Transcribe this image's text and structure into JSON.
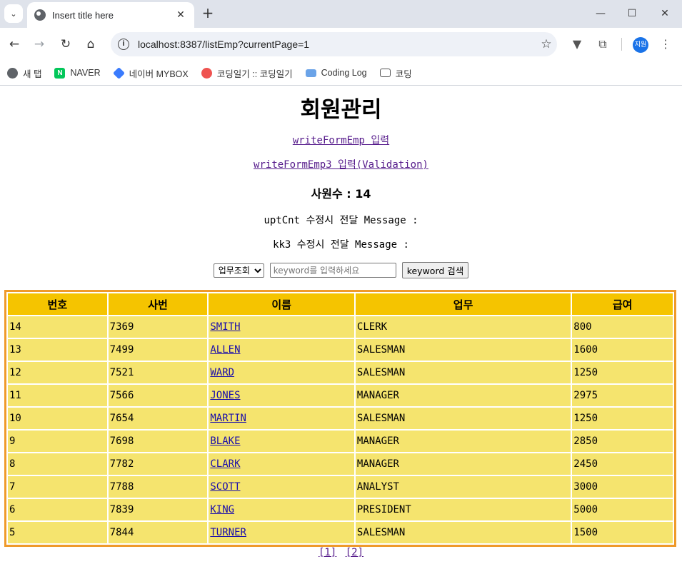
{
  "browser": {
    "tab_title": "Insert title here",
    "url": "localhost:8387/listEmp?currentPage=1",
    "profile_label": "지원",
    "bookmarks": [
      {
        "label": "새 탭",
        "icon": "globe-icon"
      },
      {
        "label": "NAVER",
        "icon": "naver-icon",
        "glyph": "N"
      },
      {
        "label": "네이버 MYBOX",
        "icon": "mybox-icon"
      },
      {
        "label": "코딩일기 :: 코딩일기",
        "icon": "coding-diary-icon"
      },
      {
        "label": "Coding Log",
        "icon": "monitor-icon"
      },
      {
        "label": "코딩",
        "icon": "folder-icon"
      }
    ]
  },
  "page": {
    "title": "회원관리",
    "link1": "writeFormEmp 입력",
    "link2": "writeFormEmp3 입력(Validation)",
    "employee_count_line": "사원수 : 14",
    "message1": "uptCnt 수정시 전달 Message :",
    "message2": "kk3 수정시 전달 Message :",
    "search": {
      "select_value": "업무조회",
      "placeholder": "keyword를 입력하세요",
      "button_label": "keyword 검색"
    },
    "table": {
      "headers": [
        "번호",
        "사번",
        "이름",
        "업무",
        "급여"
      ],
      "rows": [
        [
          "14",
          "7369",
          "SMITH",
          "CLERK",
          "800"
        ],
        [
          "13",
          "7499",
          "ALLEN",
          "SALESMAN",
          "1600"
        ],
        [
          "12",
          "7521",
          "WARD",
          "SALESMAN",
          "1250"
        ],
        [
          "11",
          "7566",
          "JONES",
          "MANAGER",
          "2975"
        ],
        [
          "10",
          "7654",
          "MARTIN",
          "SALESMAN",
          "1250"
        ],
        [
          "9",
          "7698",
          "BLAKE",
          "MANAGER",
          "2850"
        ],
        [
          "8",
          "7782",
          "CLARK",
          "MANAGER",
          "2450"
        ],
        [
          "7",
          "7788",
          "SCOTT",
          "ANALYST",
          "3000"
        ],
        [
          "6",
          "7839",
          "KING",
          "PRESIDENT",
          "5000"
        ],
        [
          "5",
          "7844",
          "TURNER",
          "SALESMAN",
          "1500"
        ]
      ]
    },
    "pager": [
      "[1]",
      "[2]"
    ]
  },
  "colors": {
    "header_cell": "#f5c400",
    "body_cell": "#f5e46e",
    "table_border": "#ef9a2a",
    "visited_link": "#551a8b",
    "link": "#1a0dab"
  }
}
